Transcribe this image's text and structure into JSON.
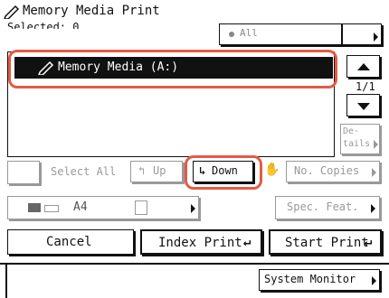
{
  "header": {
    "title": "Memory Media Print",
    "selected_label": "Selected: 0",
    "filter_select": "All"
  },
  "file_list": {
    "selected_item": "Memory Media (A:)",
    "page": "1/1",
    "details_label_1": "De-",
    "details_label_2": "tails"
  },
  "toolbar": {
    "select_all": "Select All",
    "up": "Up",
    "down": "Down",
    "no_copies": "No. Copies"
  },
  "row2": {
    "paper": "A4",
    "spec_feat": "Spec. Feat."
  },
  "actions": {
    "cancel": "Cancel",
    "index_print": "Index Print",
    "start_print": "Start Print"
  },
  "footer": {
    "system_monitor": "System Monitor"
  },
  "colors": {
    "highlight": "#e35b45",
    "selected_row_bg": "#111111",
    "disabled": "#999999"
  }
}
